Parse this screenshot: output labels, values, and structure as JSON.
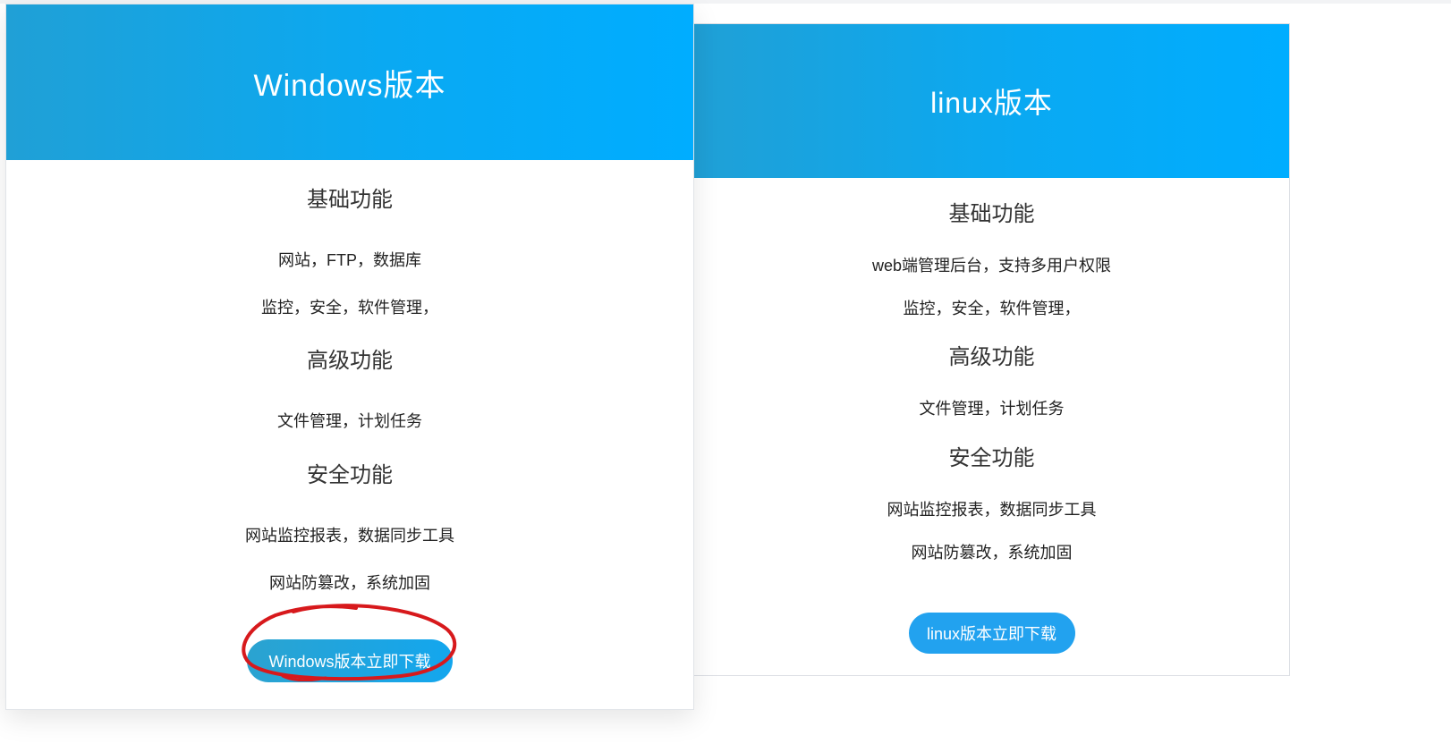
{
  "windows": {
    "title": "Windows版本",
    "sections": [
      {
        "title": "基础功能",
        "items": [
          "网站，FTP，数据库",
          "监控，安全，软件管理，"
        ]
      },
      {
        "title": "高级功能",
        "items": [
          "文件管理，计划任务"
        ]
      },
      {
        "title": "安全功能",
        "items": [
          "网站监控报表，数据同步工具",
          "网站防篡改，系统加固"
        ]
      }
    ],
    "download_label": "Windows版本立即下载"
  },
  "linux": {
    "title": "linux版本",
    "sections": [
      {
        "title": "基础功能",
        "items": [
          "web端管理后台，支持多用户权限",
          "监控，安全，软件管理，"
        ]
      },
      {
        "title": "高级功能",
        "items": [
          "文件管理，计划任务"
        ]
      },
      {
        "title": "安全功能",
        "items": [
          "网站监控报表，数据同步工具",
          "网站防篡改，系统加固"
        ]
      }
    ],
    "download_label": "linux版本立即下载"
  },
  "colors": {
    "header_blue": "#00adff",
    "button_blue": "#22a2ef",
    "annotation_red": "#d7191c"
  }
}
